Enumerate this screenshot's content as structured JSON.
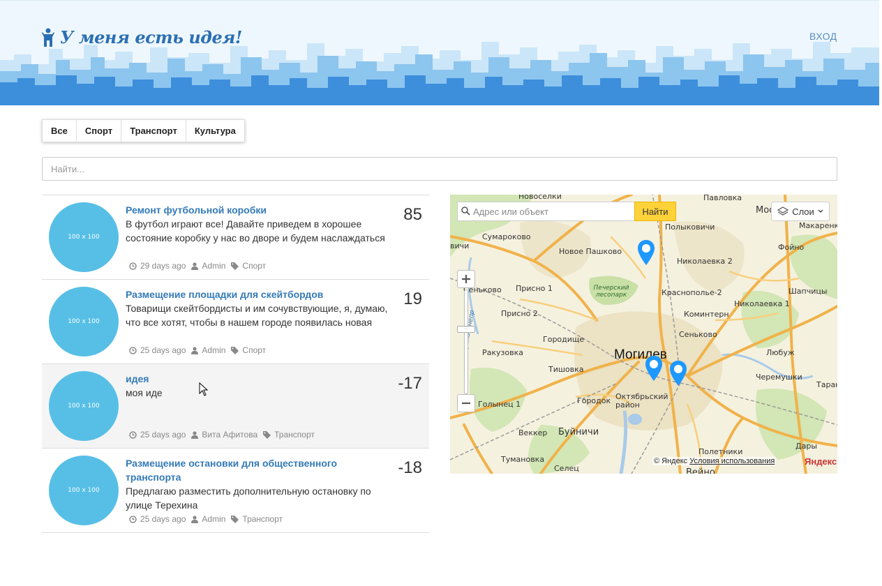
{
  "header": {
    "logo_text": "У меня есть идея!",
    "login_label": "ВХОД",
    "logo_icon": "person-icon"
  },
  "filters": [
    {
      "label": "Все"
    },
    {
      "label": "Спорт"
    },
    {
      "label": "Транспорт"
    },
    {
      "label": "Культура"
    }
  ],
  "search": {
    "placeholder": "Найти..."
  },
  "ideas": [
    {
      "thumb": "100 x 100",
      "title": "Ремонт футбольной коробки",
      "description": "В футбол играют все! Давайте приведем в хорошее состояние коробку у нас во дворе и будем наслаждаться",
      "score": "85",
      "time": "29 days ago",
      "author": "Admin",
      "category": "Спорт"
    },
    {
      "thumb": "100 x 100",
      "title": "Размещение площадки для скейтбордов",
      "description": "Товарищи скейтбордисты и им сочувствующие, я, думаю, что все хотят, чтобы в нашем городе появилась новая",
      "score": "19",
      "time": "25 days ago",
      "author": "Admin",
      "category": "Спорт"
    },
    {
      "thumb": "100 x 100",
      "title": "идея",
      "description": "моя иде",
      "score": "-17",
      "time": "25 days ago",
      "author": "Вита Афитова",
      "category": "Транспорт"
    },
    {
      "thumb": "100 x 100",
      "title": "Размещение остановки для общественного транспорта",
      "description": "Предлагаю разместить дополнительную остановку по улице Терехина",
      "score": "-18",
      "time": "25 days ago",
      "author": "Admin",
      "category": "Транспорт"
    }
  ],
  "map": {
    "search_placeholder": "Адрес или объект",
    "find_label": "Найти",
    "layers_label": "Слои",
    "copyright": "© Яндекс",
    "terms_link": "Условия использования",
    "brand": "Яндекс",
    "labels": {
      "novoselki": "Новоселки",
      "pavlovka": "Павловка",
      "mos": "Мос",
      "polykovichi": "Полыковичи",
      "makarenk": "Макаренк",
      "sumarokovo": "Сумароково",
      "vichi": "вичи",
      "novoe_pashkovo": "Новое Пашково",
      "foyno": "Фойно",
      "nikolaevka2": "Николаевка 2",
      "senkovo_w": "Сеньково",
      "prisno1": "Присно 1",
      "pechersky": "Печерский лесопарк",
      "krasnopolie2": "Краснополье-2",
      "shapchicy": "Шапчицы",
      "nikolaevka1": "Николаевка 1",
      "prisno2": "Присно 2",
      "kominter": "Коминтерн",
      "gorodishche": "Городище",
      "senkovo_e": "Сеньково",
      "rakuzovka": "Ракузовка",
      "lyubuzh": "Любуж",
      "mogilev": "Могилев",
      "tishovka": "Тишовка",
      "cheremushki": "Черемушки",
      "taranovka": "Тарано",
      "golynec": "Голынец 1",
      "gorodok": "Городок",
      "oktyabrsky": "Октябрьский район",
      "buynichi": "Буйничи",
      "vekker": "Веккер",
      "dary": "Дары",
      "poletniki": "Полетники",
      "tumanovka": "Тумановка",
      "selec": "Селец",
      "veyno": "Вейно",
      "river": "река Днепр"
    }
  }
}
